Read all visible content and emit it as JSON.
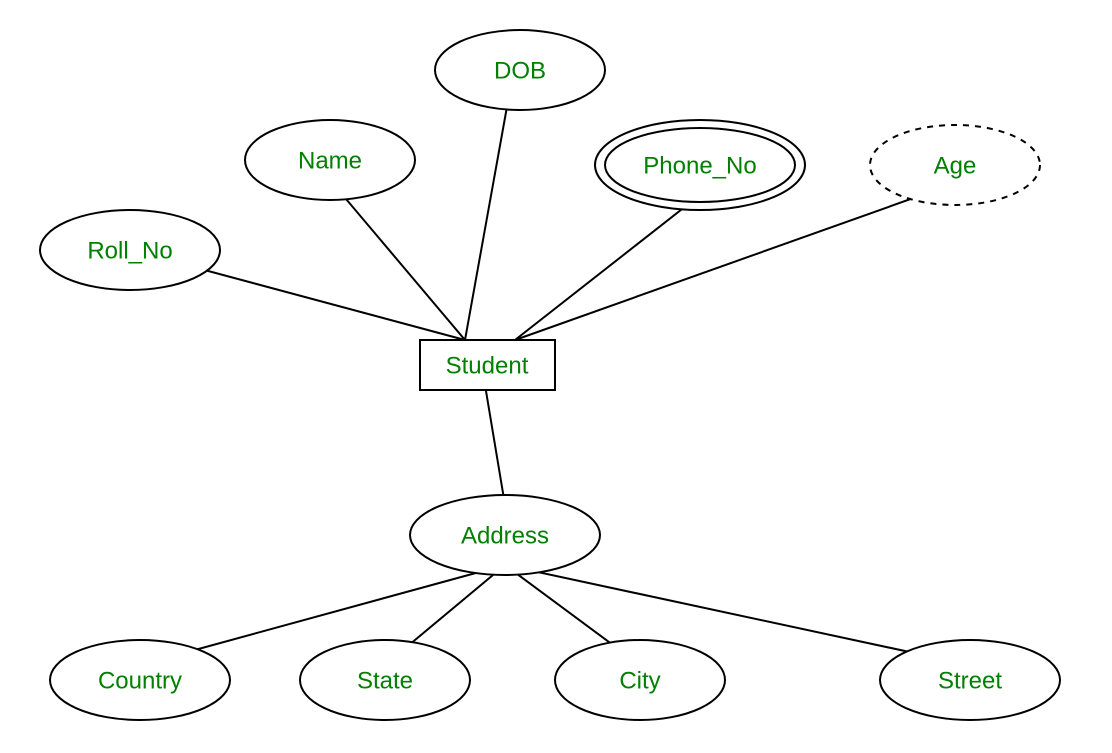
{
  "diagram": {
    "type": "er-diagram",
    "entity": {
      "label": "Student"
    },
    "attributes": {
      "roll_no": {
        "label": "Roll_No",
        "kind": "simple"
      },
      "name": {
        "label": "Name",
        "kind": "simple"
      },
      "dob": {
        "label": "DOB",
        "kind": "simple"
      },
      "phone_no": {
        "label": "Phone_No",
        "kind": "multivalued"
      },
      "age": {
        "label": "Age",
        "kind": "derived"
      },
      "address": {
        "label": "Address",
        "kind": "composite"
      }
    },
    "sub_attributes": {
      "country": {
        "label": "Country",
        "parent": "address"
      },
      "state": {
        "label": "State",
        "parent": "address"
      },
      "city": {
        "label": "City",
        "parent": "address"
      },
      "street": {
        "label": "Street",
        "parent": "address"
      }
    }
  }
}
